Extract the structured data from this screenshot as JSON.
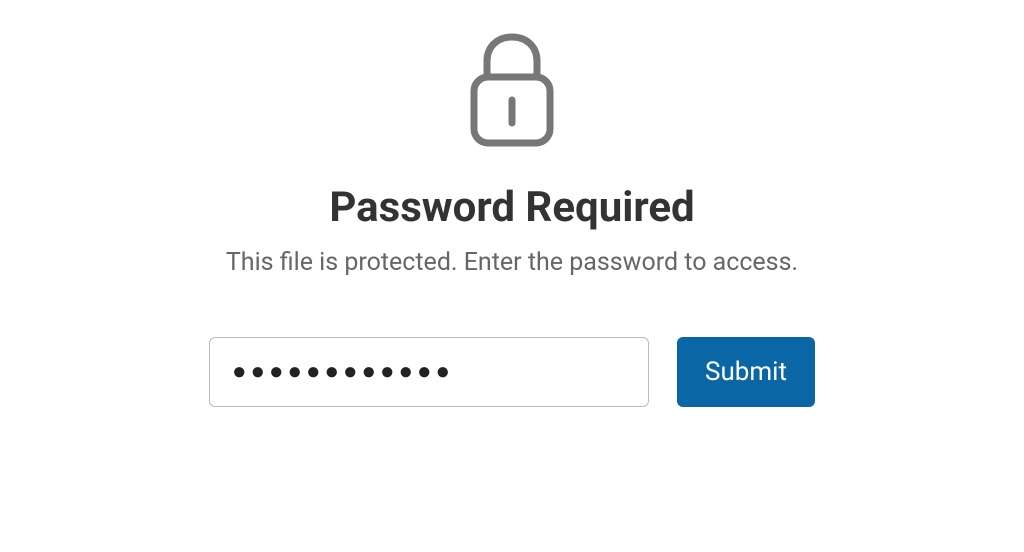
{
  "header": {
    "title": "Password Required",
    "subtitle": "This file is protected. Enter the password to access."
  },
  "form": {
    "password_value": "●●●●●●●●●●●●",
    "submit_label": "Submit"
  },
  "icons": {
    "lock": "lock-icon"
  },
  "colors": {
    "title_text": "#333333",
    "subtitle_text": "#666666",
    "button_bg": "#0b66a6",
    "button_text": "#ffffff",
    "input_border": "#bbbbbb",
    "icon_stroke": "#777777"
  }
}
